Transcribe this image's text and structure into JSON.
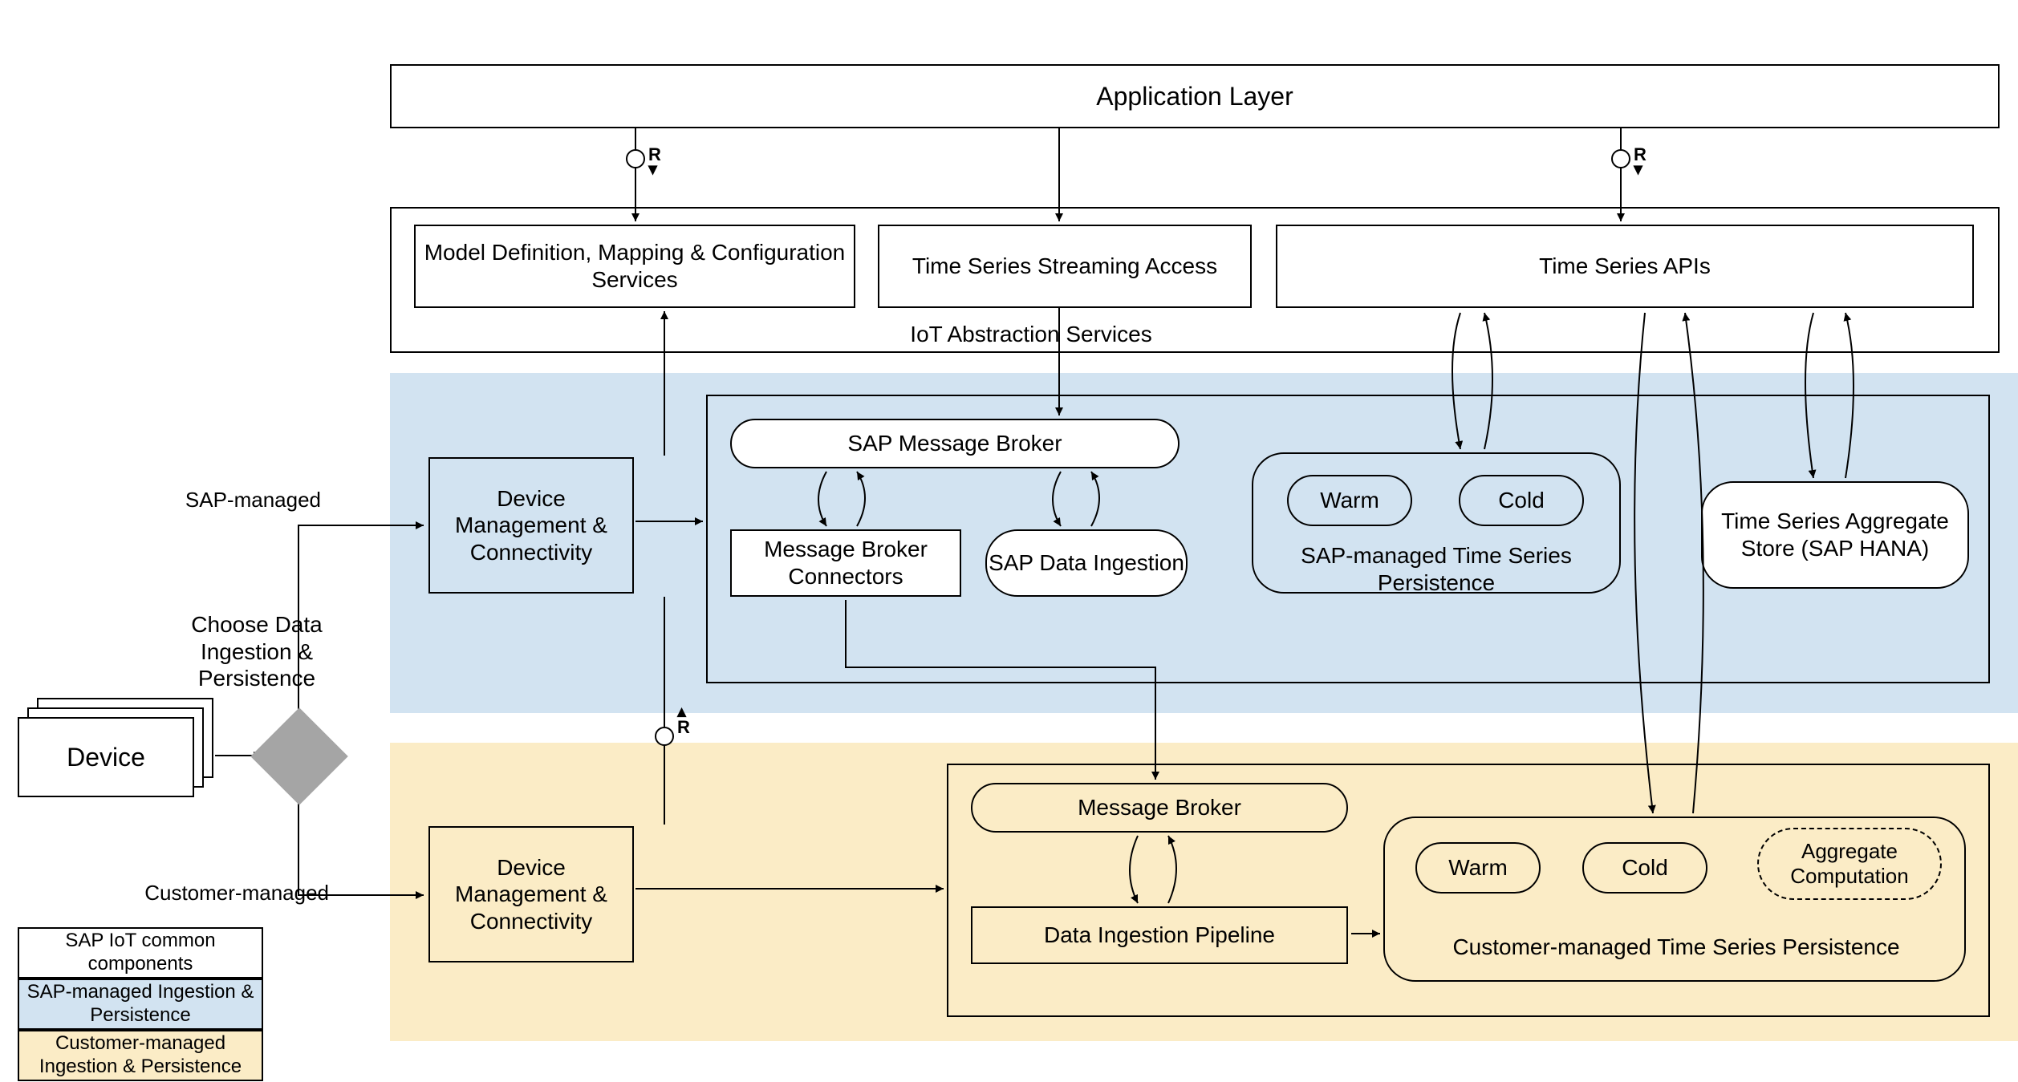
{
  "applicationLayer": "Application Layer",
  "abstraction": {
    "title": "IoT Abstraction Services",
    "model": "Model Definition, Mapping & Configuration Services",
    "streaming": "Time Series Streaming Access",
    "apis": "Time Series APIs"
  },
  "sap": {
    "deviceMgmt": "Device Management & Connectivity",
    "messageBroker": "SAP Message Broker",
    "connectors": "Message Broker Connectors",
    "ingestion": "SAP Data Ingestion",
    "persistenceTitle": "SAP-managed Time Series Persistence",
    "warm": "Warm",
    "cold": "Cold",
    "aggregate": "Time Series Aggregate Store (SAP HANA)"
  },
  "customer": {
    "deviceMgmt": "Device Management & Connectivity",
    "messageBroker": "Message Broker",
    "pipeline": "Data Ingestion Pipeline",
    "persistenceTitle": "Customer-managed Time Series Persistence",
    "warm": "Warm",
    "cold": "Cold",
    "aggregate": "Aggregate Computation"
  },
  "device": "Device",
  "choose": "Choose Data Ingestion & Persistence",
  "branchSap": "SAP-managed",
  "branchCustomer": "Customer-managed",
  "legend": {
    "common": "SAP IoT common components",
    "sap": "SAP-managed Ingestion & Persistence",
    "customer": "Customer-managed Ingestion & Persistence"
  },
  "rLabel": "R"
}
